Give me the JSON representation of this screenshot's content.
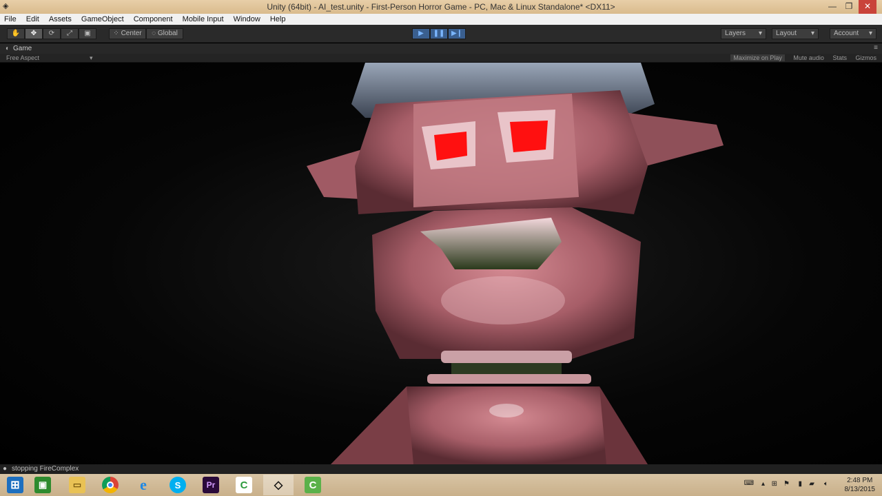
{
  "window": {
    "title": "Unity (64bit) - AI_test.unity - First-Person Horror Game - PC, Mac & Linux Standalone* <DX11>",
    "minimize_glyph": "—",
    "maximize_glyph": "❐",
    "close_glyph": "✕"
  },
  "menu": [
    "File",
    "Edit",
    "Assets",
    "GameObject",
    "Component",
    "Mobile Input",
    "Window",
    "Help"
  ],
  "toolbar": {
    "pivot_label": "Center",
    "space_label": "Global",
    "layers_label": "Layers",
    "layout_label": "Layout",
    "account_label": "Account"
  },
  "game_view": {
    "tab_label": "Game",
    "aspect_label": "Free Aspect",
    "options": [
      "Maximize on Play",
      "Mute audio",
      "Stats",
      "Gizmos"
    ]
  },
  "status": {
    "message": "stopping FireComplex"
  },
  "taskbar": {
    "icons": [
      "windows-start-icon",
      "store-icon",
      "file-explorer-icon",
      "chrome-icon",
      "internet-explorer-icon",
      "skype-icon",
      "premiere-icon",
      "camtasia-icon",
      "unity-icon",
      "camtasia-recorder-icon"
    ],
    "time": "2:48 PM",
    "date": "8/13/2015"
  },
  "colors": {
    "robot_pink": "#b86a74",
    "robot_eyes": "#ff1010",
    "play_accent": "#3a5f8f"
  }
}
